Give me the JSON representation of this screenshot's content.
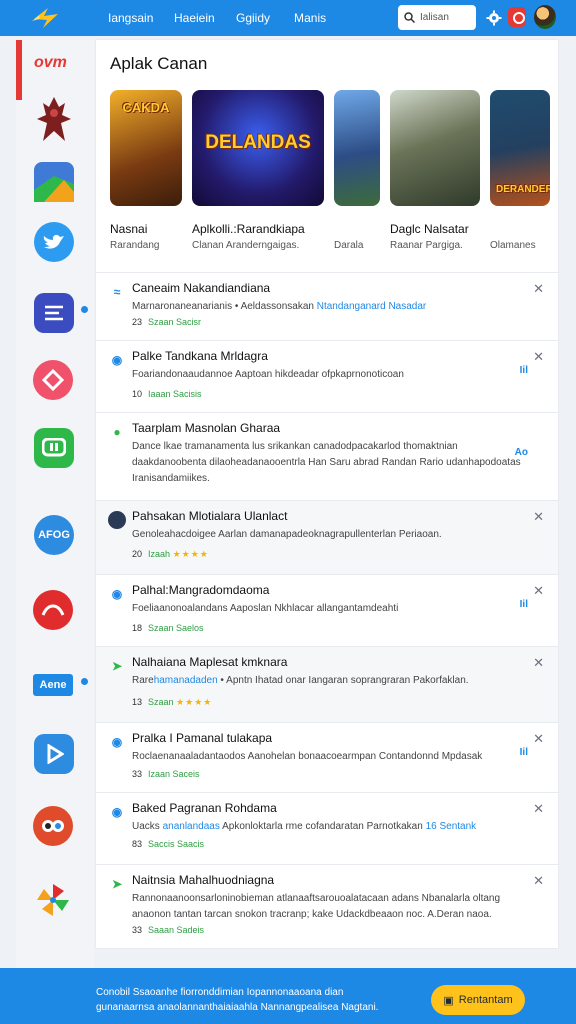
{
  "header": {
    "nav": [
      "Іаngsain",
      "Нaeiein",
      "Ggiidy",
      "Маnis"
    ],
    "search_placeholder": "Іаlisan",
    "icons": {
      "logo": "lightning-logo",
      "search": "search-icon",
      "settings": "gear-icon",
      "notifications": "bell-icon"
    },
    "accent": "#1e88e5"
  },
  "sidebar": {
    "badge_label": "ovm",
    "items": [
      {
        "name": "warrior-app",
        "color": "#8b1e1e"
      },
      {
        "name": "maps-app",
        "color": "#3f7bd6"
      },
      {
        "name": "twitter-app",
        "color": "#2d9bf0"
      },
      {
        "name": "notes-app",
        "color": "#3b4cc0"
      },
      {
        "name": "play-app",
        "color": "#f0516b"
      },
      {
        "name": "chat-app",
        "color": "#2eb84a"
      },
      {
        "name": "afog-app",
        "color": "#2d8be0",
        "label": "AFOG"
      },
      {
        "name": "signal-app",
        "color": "#e02c2c"
      },
      {
        "name": "aene-app",
        "color": "#1e88e5",
        "label": "Aene"
      },
      {
        "name": "video-app",
        "color": "#2d8be0"
      },
      {
        "name": "owl-app",
        "color": "#e04b2c"
      },
      {
        "name": "pinwheel-app",
        "color": "#f3a21c"
      }
    ]
  },
  "main": {
    "title": "Aplak Canan",
    "cards": [
      {
        "art": "CAKDA",
        "title": "Nasnai",
        "sub": "Rarandang"
      },
      {
        "art": "DELANDAS",
        "title": "Aplkolli.:Rarandkiapa",
        "sub": "Clanan Aranderngaigas."
      },
      {
        "art": "",
        "title": "",
        "sub": "Darala"
      },
      {
        "art": "",
        "title": "Daglc Nalsatar",
        "sub": "Raanar Pargiga."
      },
      {
        "art": "DERANDER",
        "title": "",
        "sub": "Olamanes"
      }
    ],
    "rows": [
      {
        "icon": "wave",
        "title": "Caneaim Nakandiandiana",
        "desc": "Marnaronaneanarianis • Aeldassonsakan",
        "desc_link": "Ntandanganard Nasadar",
        "meta": "23",
        "meta_g": "Szaan Sacisr",
        "stars": false,
        "side": ""
      },
      {
        "icon": "circle",
        "title": "Palke Tandkana Mrldagra",
        "desc": "Foariandonaaudannoe Aaptoan hikdeadar ofpkaprnonoticoan",
        "desc_link": "",
        "meta": "10",
        "meta_g": "Iaaan Sacisis",
        "stars": false,
        "side": "Iil"
      },
      {
        "icon": "chat",
        "title": "Taarplam Masnolan Gharaa",
        "desc": "Dance lkae tramanamenta lus srikankan canadodpacakarlod thomaktnian daakdanoobenta dilaoheadanaooentrla Han Saru abrad Randan Rario udanhapodoatas Iranisandamiikes.",
        "desc_link": "",
        "meta": "",
        "meta_g": "",
        "stars": false,
        "side": "Ao"
      },
      {
        "icon": "avatar",
        "title": "Pahsakan Mlotialara Ulanlact",
        "desc": "Genoleahacdoigee Aarlan damanapadeoknagrapullenterlan Periaoan.",
        "desc_link": "",
        "meta": "20",
        "meta_g": "Izaah",
        "stars": true,
        "side": ""
      },
      {
        "icon": "circle",
        "title": "Palhal:Mangradomdaoma",
        "desc": "Foeliaanonoalandans Aaposlan Nkhlacar allangantamdeahti",
        "desc_link": "",
        "meta": "18",
        "meta_g": "Szaan Saelos",
        "stars": false,
        "side": "Iil"
      },
      {
        "icon": "arrow",
        "title": "Nalhaiana Maplesat kmknara",
        "desc": "Rare",
        "desc_link": "hamanadaden",
        "desc_tail": "• Apntn Ihatad onar Iangaran soprangraran Pakorfaklan.",
        "meta": "13",
        "meta_g": "Szaan",
        "stars": true,
        "side": ""
      },
      {
        "icon": "circle",
        "title": "Pralka I Pamanal tulakapa",
        "desc": "Roclaenanaaladantaodos Aanohelan bonaacoearmpan Contandonnd Mpdasak",
        "desc_link": "",
        "meta": "33",
        "meta_g": "Izaan Saceis",
        "stars": false,
        "side": "Iil"
      },
      {
        "icon": "circle",
        "title": "Baked Pagranan Rohdama",
        "desc": "Uacks",
        "desc_link": "ananlandaas",
        "desc_tail": "Apkonloktarla rme cofandaratan Parnotkakan",
        "desc_link2": "16 Sentank",
        "meta": "83",
        "meta_g": "Saccis Saacis",
        "stars": false,
        "side": ""
      },
      {
        "icon": "arrow",
        "title": "Naitnsia Mahalhuodniagna",
        "desc": "Rannonaanoonsarloninobieman atlanaaftsarouoalatacaan adans Nbanalarla oltang anaonon tantan tarcan snokon tracranp; kake Udackdbeaaon noc. A.Deran naoa.",
        "desc_link": "",
        "meta": "33",
        "meta_g": "Saaan Sadeis",
        "stars": false,
        "side": ""
      }
    ]
  },
  "footer": {
    "text": "Conobil Ssaoanhe fiorronddimian Iopannonaaoana dian gunanaarnsa anaolannanthaiaiaahla Nannangpealisea Nagtani.",
    "button_label": "Rentantam",
    "button_color": "#ffc21a"
  }
}
